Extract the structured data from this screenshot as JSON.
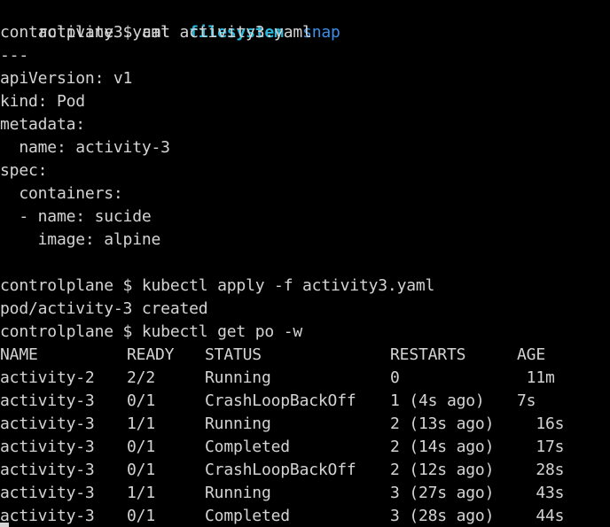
{
  "terminal": {
    "ls_line": [
      {
        "text": "activity3.yaml",
        "color": "#d4d4d4",
        "bold": false
      },
      {
        "text": "  ",
        "color": "#d4d4d4",
        "bold": false
      },
      {
        "text": "filesystem",
        "color": "#29b8db",
        "bold": true
      },
      {
        "text": "  ",
        "color": "#d4d4d4",
        "bold": false
      },
      {
        "text": "snap",
        "color": "#3b8eea",
        "bold": false
      }
    ],
    "lines": [
      "controlplane $ cat activity3.yaml",
      "---",
      "apiVersion: v1",
      "kind: Pod",
      "metadata:",
      "  name: activity-3",
      "spec:",
      "  containers:",
      "  - name: sucide",
      "    image: alpine",
      "",
      "controlplane $ kubectl apply -f activity3.yaml",
      "pod/activity-3 created",
      "controlplane $ kubectl get po -w"
    ],
    "table": {
      "headers": {
        "name": "NAME",
        "ready": "READY",
        "status": "STATUS",
        "restarts": "RESTARTS",
        "age": "AGE"
      },
      "rows": [
        {
          "name": "activity-2",
          "ready": "2/2",
          "status": "Running",
          "restarts": "0",
          "age": " 11m"
        },
        {
          "name": "activity-3",
          "ready": "0/1",
          "status": "CrashLoopBackOff",
          "restarts": "1 (4s ago)",
          "age": "7s"
        },
        {
          "name": "activity-3",
          "ready": "1/1",
          "status": "Running",
          "restarts": "2 (13s ago)",
          "age": "  16s"
        },
        {
          "name": "activity-3",
          "ready": "0/1",
          "status": "Completed",
          "restarts": "2 (14s ago)",
          "age": "  17s"
        },
        {
          "name": "activity-3",
          "ready": "0/1",
          "status": "CrashLoopBackOff",
          "restarts": "2 (12s ago)",
          "age": "  28s"
        },
        {
          "name": "activity-3",
          "ready": "1/1",
          "status": "Running",
          "restarts": "3 (27s ago)",
          "age": "  43s"
        },
        {
          "name": "activity-3",
          "ready": "0/1",
          "status": "Completed",
          "restarts": "3 (28s ago)",
          "age": "  44s"
        }
      ]
    }
  },
  "colors": {
    "background": "#000000",
    "foreground": "#d4d4d4"
  }
}
